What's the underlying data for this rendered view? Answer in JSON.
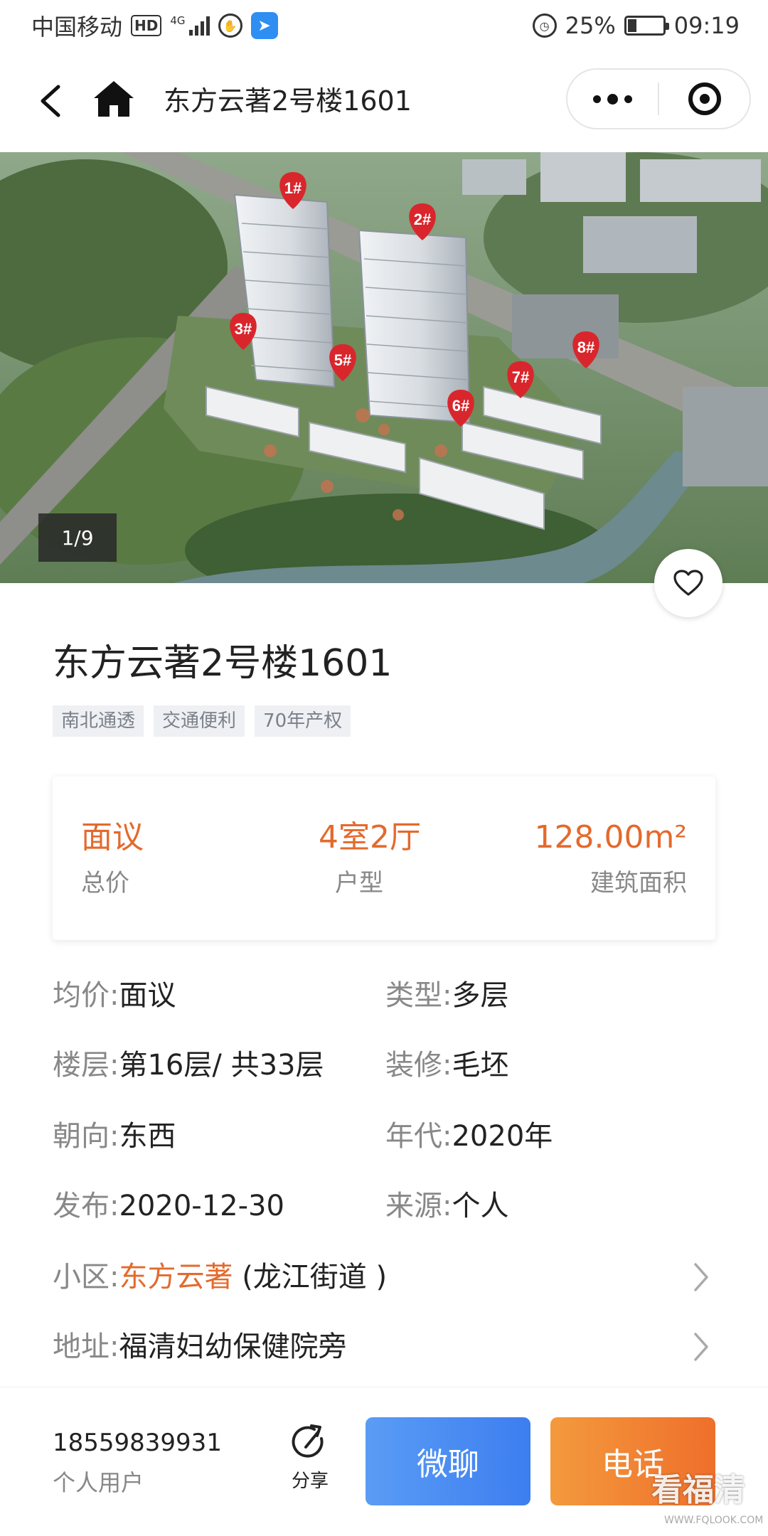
{
  "status_bar": {
    "carrier": "中国移动",
    "hd_badge": "HD",
    "network": "4G",
    "battery": "25%",
    "battery_level": 0.25,
    "time": "09:19"
  },
  "nav": {
    "title": "东方云著2号楼1601"
  },
  "hero": {
    "counter": "1/9",
    "building_markers": [
      "1#",
      "2#",
      "3#",
      "5#",
      "6#",
      "7#",
      "8#"
    ]
  },
  "listing": {
    "title": "东方云著2号楼1601",
    "tags": [
      "南北通透",
      "交通便利",
      "70年产权"
    ]
  },
  "facts": {
    "price_value": "面议",
    "price_label": "总价",
    "layout_value": "4室2厅",
    "layout_label": "户型",
    "area_value": "128.00m²",
    "area_label": "建筑面积"
  },
  "details": {
    "avg_price_key": "均价:",
    "avg_price_val": "面议",
    "type_key": "类型:",
    "type_val": "多层",
    "floor_key": "楼层:",
    "floor_val": "第16层/ 共33层",
    "decoration_key": "装修:",
    "decoration_val": "毛坯",
    "orientation_key": "朝向:",
    "orientation_val": "东西",
    "year_key": "年代:",
    "year_val": "2020年",
    "published_key": "发布:",
    "published_val": "2020-12-30",
    "source_key": "来源:",
    "source_val": "个人",
    "community_key": "小区:",
    "community_name": "东方云著",
    "community_district": " (龙江街道 )",
    "address_key": "地址:",
    "address_val": "福清妇幼保健院旁"
  },
  "bottom": {
    "phone": "18559839931",
    "role": "个人用户",
    "share_label": "分享",
    "chat_button": "微聊",
    "call_button": "电话"
  },
  "watermark": {
    "text": "看福清",
    "url": "WWW.FQLOOK.COM"
  },
  "colors": {
    "accent_orange": "#e36a2d",
    "chat_blue": "#3d7ef0",
    "marker_red": "#d9262c"
  }
}
